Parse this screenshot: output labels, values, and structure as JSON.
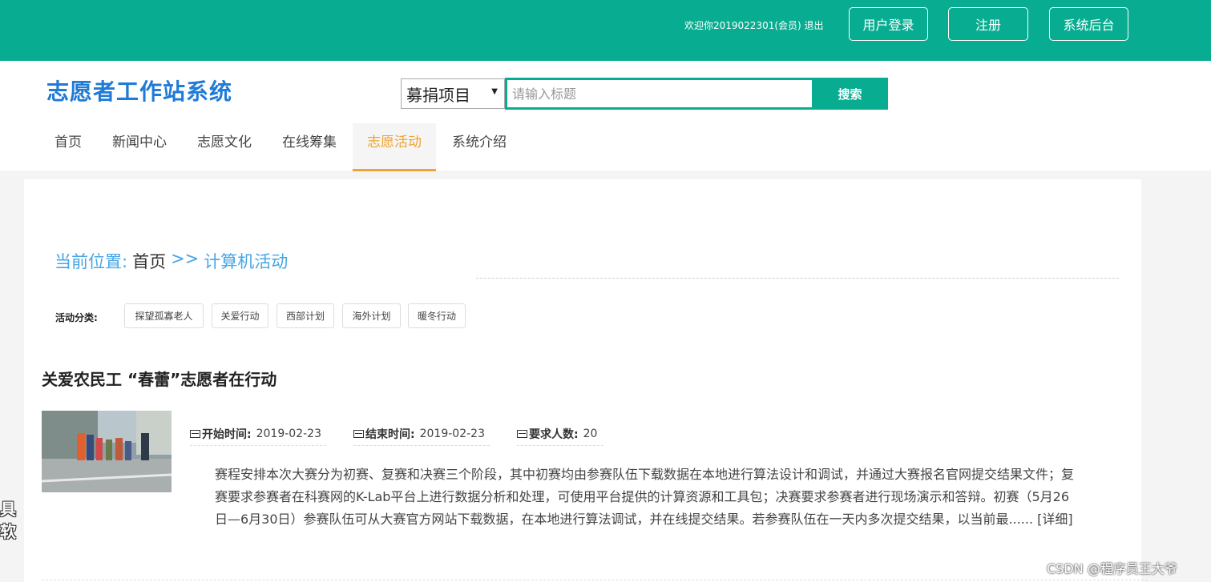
{
  "topbar": {
    "welcome": "欢迎你2019022301(会员) 退出",
    "login_label": "用户登录",
    "register_label": "注册",
    "admin_label": "系统后台"
  },
  "header": {
    "logo": "志愿者工作站系统",
    "search": {
      "category": "募捐项目",
      "placeholder": "请输入标题",
      "button_label": "搜索"
    }
  },
  "nav": {
    "items": [
      {
        "label": "首页"
      },
      {
        "label": "新闻中心"
      },
      {
        "label": "志愿文化"
      },
      {
        "label": "在线筹集"
      },
      {
        "label": "志愿活动",
        "active": true
      },
      {
        "label": "系统介绍"
      }
    ]
  },
  "breadcrumb": {
    "prefix": "当前位置:",
    "home": "首页",
    "separator": ">>",
    "current": "计算机活动"
  },
  "categories": {
    "label": "活动分类:",
    "items": [
      "探望孤寡老人",
      "关爱行动",
      "西部计划",
      "海外计划",
      "暖冬行动"
    ]
  },
  "activity": {
    "title": "关爱农民工 “春蕾”志愿者在行动",
    "start_label": "开始时间:",
    "start_date": "2019-02-23",
    "end_label": "结束时间:",
    "end_date": "2019-02-23",
    "people_label": "要求人数:",
    "people": "20",
    "description": "赛程安排本次大赛分为初赛、复赛和决赛三个阶段，其中初赛均由参赛队伍下载数据在本地进行算法设计和调试，并通过大赛报名官网提交结果文件；复赛要求参赛者在科赛网的K-Lab平台上进行数据分析和处理，可使用平台提供的计算资源和工具包；决赛要求参赛者进行现场演示和答辩。初赛（5月26日—6月30日）参赛队伍可从大赛官方网站下载数据，在本地进行算法调试，并在线提交结果。若参赛队伍在一天内多次提交结果，以当前最......",
    "more": "[详细]"
  },
  "overlay": {
    "watermark": "CSDN @程序员王大爷",
    "left_text_1": "具",
    "left_text_2": "软"
  },
  "colors": {
    "brand": "#08ad91",
    "logo": "#1f7bd6",
    "active_nav": "#f0a330",
    "breadcrumb": "#46a6e6"
  }
}
